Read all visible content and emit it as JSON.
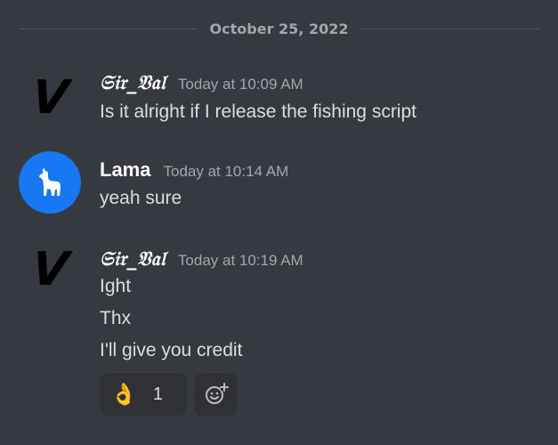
{
  "divider": {
    "date": "October 25, 2022"
  },
  "messages": [
    {
      "username": "𝔖𝔦𝔯_𝔙𝔞𝔩",
      "avatar_letter": "V",
      "timestamp": "Today at 10:09 AM",
      "lines": [
        "Is it alright if I release the fishing script"
      ]
    },
    {
      "username": "Lama",
      "avatar_icon": "llama-icon",
      "avatar_color": "#1877f2",
      "timestamp": "Today at 10:14 AM",
      "lines": [
        "yeah sure"
      ]
    },
    {
      "username": "𝔖𝔦𝔯_𝔙𝔞𝔩",
      "avatar_letter": "V",
      "timestamp": "Today at 10:19 AM",
      "lines": [
        "Ight",
        "Thx",
        "I'll give you credit"
      ]
    }
  ],
  "reactions": [
    {
      "emoji": "👌",
      "count": "1"
    }
  ],
  "add_reaction_icon": "add-reaction-icon",
  "colors": {
    "background": "#36393f",
    "reaction_bg": "#2f3136",
    "text": "#dcddde",
    "muted": "#a3a6aa"
  }
}
